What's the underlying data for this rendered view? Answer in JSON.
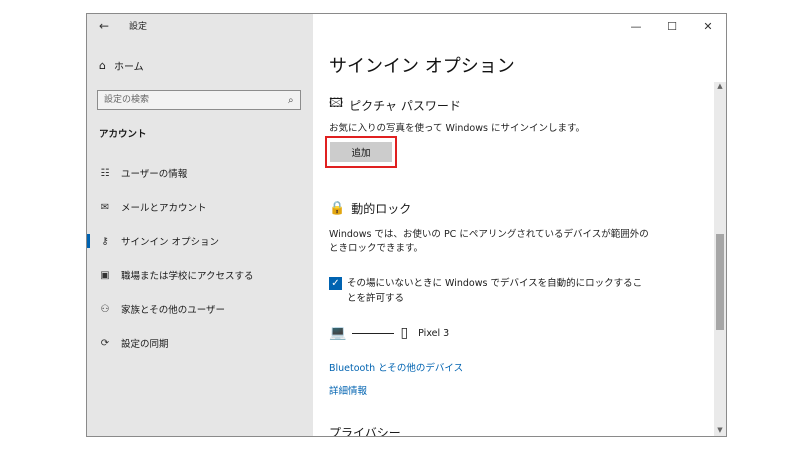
{
  "titlebar": {
    "back_icon": "back-arrow-icon",
    "title": "設定",
    "minimize": "—",
    "maximize": "☐",
    "close": "✕"
  },
  "sidebar": {
    "home_label": "ホーム",
    "search_placeholder": "設定の検索",
    "section_title": "アカウント",
    "items": [
      {
        "label": "ユーザーの情報",
        "icon": "user-info-icon"
      },
      {
        "label": "メールとアカウント",
        "icon": "mail-icon"
      },
      {
        "label": "サインイン オプション",
        "icon": "key-icon",
        "active": true
      },
      {
        "label": "職場または学校にアクセスする",
        "icon": "briefcase-icon"
      },
      {
        "label": "家族とその他のユーザー",
        "icon": "people-icon"
      },
      {
        "label": "設定の同期",
        "icon": "sync-icon"
      }
    ]
  },
  "main": {
    "title": "サインイン オプション",
    "picture_password": {
      "heading": "ピクチャ パスワード",
      "description": "お気に入りの写真を使って Windows にサインインします。",
      "add_button": "追加"
    },
    "dynamic_lock": {
      "heading": "動的ロック",
      "description": "Windows では、お使いの PC にペアリングされているデバイスが範囲外のときロックできます。",
      "checkbox_label": "その場にいないときに Windows でデバイスを自動的にロックすることを許可する",
      "checked": true,
      "device_name": "Pixel 3"
    },
    "links": {
      "bluetooth": "Bluetooth とその他のデバイス",
      "details": "詳細情報"
    },
    "privacy_heading": "プライバシー"
  },
  "colors": {
    "accent": "#0063b1",
    "highlight_border": "#e02020",
    "sidebar_bg": "#e6e6e6"
  }
}
